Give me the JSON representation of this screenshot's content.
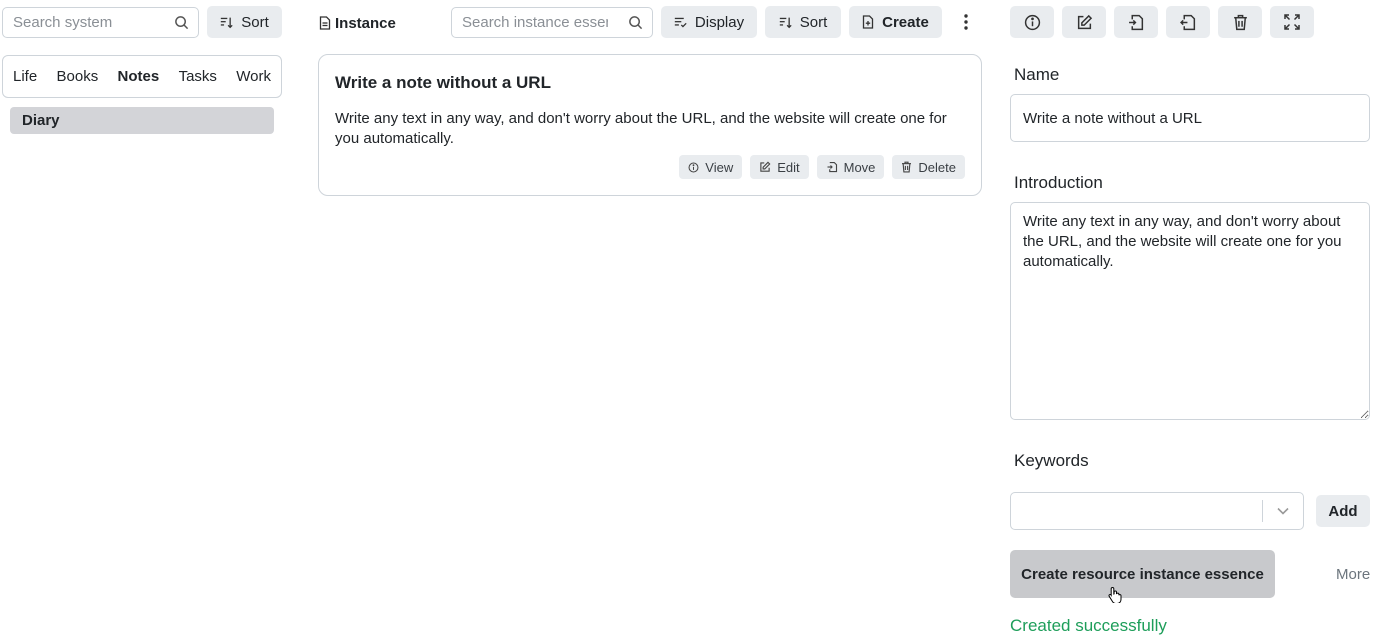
{
  "left": {
    "search_placeholder": "Search system",
    "sort_label": "Sort",
    "tabs": [
      {
        "label": "Life"
      },
      {
        "label": "Books"
      },
      {
        "label": "Notes"
      },
      {
        "label": "Tasks"
      },
      {
        "label": "Work"
      }
    ],
    "active_tab": "Notes",
    "selected_item": "Diary"
  },
  "middle": {
    "title": "Instance",
    "search_placeholder": "Search instance essence",
    "display_label": "Display",
    "sort_label": "Sort",
    "create_label": "Create",
    "card": {
      "title": "Write a note without a URL",
      "text": "Write any text in any way, and don't worry about the URL, and the website will create one for you automatically.",
      "actions": {
        "view": "View",
        "edit": "Edit",
        "move": "Move",
        "delete": "Delete"
      }
    }
  },
  "right": {
    "toolbar_icons": [
      "info-icon",
      "edit-icon",
      "file-import-icon",
      "file-export-icon",
      "trash-icon",
      "fullscreen-icon"
    ],
    "name_label": "Name",
    "name_value": "Write a note without a URL",
    "intro_label": "Introduction",
    "intro_value": "Write any text in any way, and don't worry about the URL, and the website will create one for you automatically.",
    "keywords_label": "Keywords",
    "keywords_value": "",
    "add_label": "Add",
    "create_label": "Create resource instance essence",
    "more_label": "More",
    "status": "Created successfully",
    "status_color": "#1e9e5a"
  }
}
